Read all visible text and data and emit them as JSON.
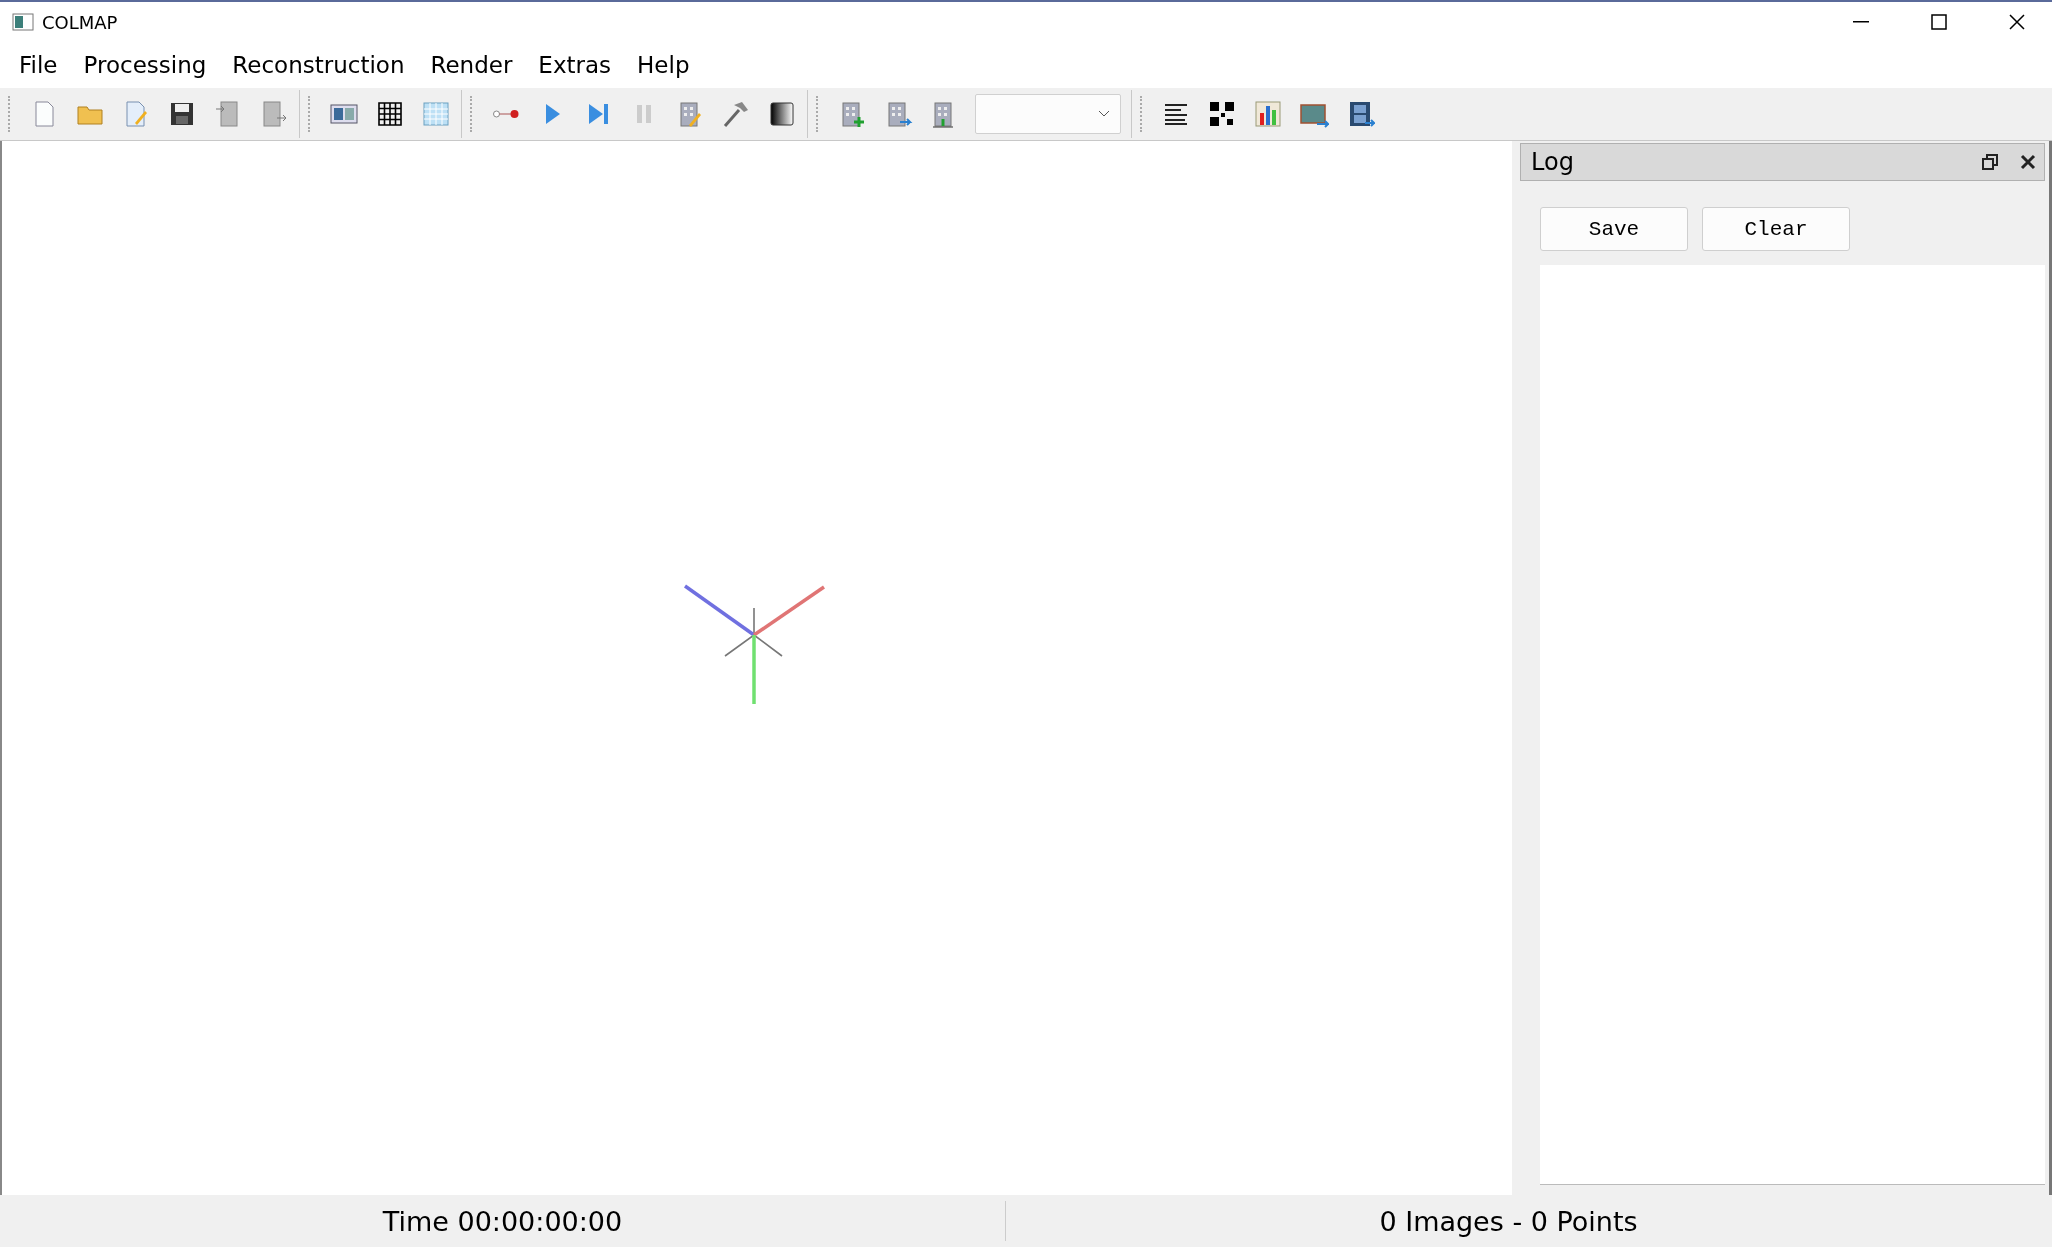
{
  "window": {
    "title": "COLMAP"
  },
  "menu": [
    "File",
    "Processing",
    "Reconstruction",
    "Render",
    "Extras",
    "Help"
  ],
  "log_panel": {
    "title": "Log",
    "buttons": [
      "Save",
      "Clear"
    ]
  },
  "status_bar": {
    "time": "Time 00:00:00:00",
    "counts": "0 Images - 0 Points"
  }
}
